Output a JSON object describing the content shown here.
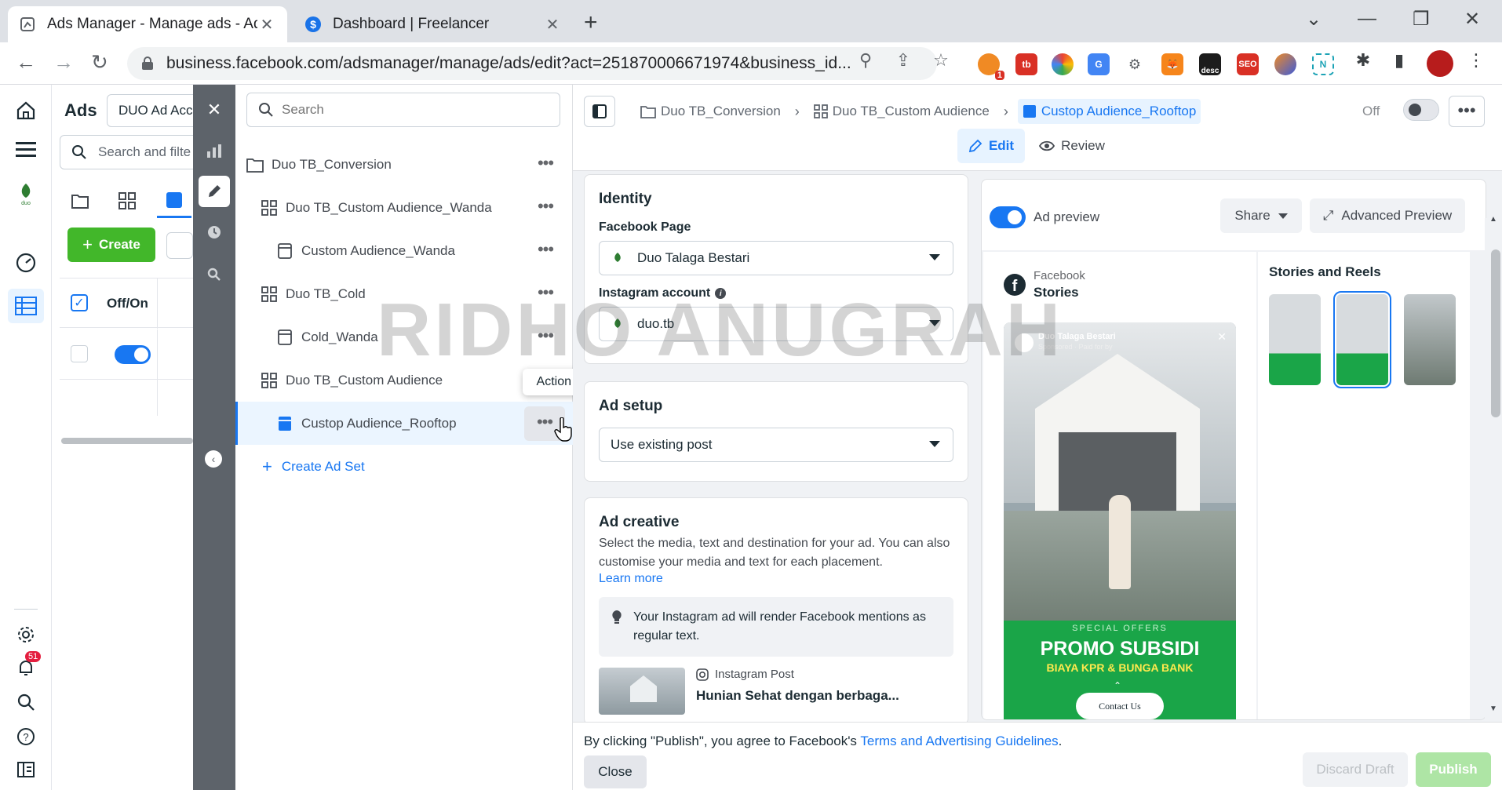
{
  "browser": {
    "tabs": [
      {
        "title": "Ads Manager - Manage ads - Ad",
        "active": true
      },
      {
        "title": "Dashboard | Freelancer",
        "active": false
      }
    ],
    "url": "business.facebook.com/adsmanager/manage/ads/edit?act=251870006671974&business_id...",
    "ext_badge": "1",
    "ext_desc": "desc",
    "ext_seo": "SEO"
  },
  "appnav": {
    "notif_count": "51"
  },
  "ads_panel": {
    "title": "Ads",
    "account": "DUO Ad Acco",
    "search_placeholder": "Search and filte",
    "create_label": "Create",
    "col_header": "Off/On"
  },
  "tree": {
    "search_placeholder": "Search",
    "items": [
      {
        "label": "Duo TB_Conversion",
        "type": "campaign"
      },
      {
        "label": "Duo TB_Custom Audience_Wanda",
        "type": "adset"
      },
      {
        "label": "Custom Audience_Wanda",
        "type": "ad"
      },
      {
        "label": "Duo TB_Cold",
        "type": "adset"
      },
      {
        "label": "Cold_Wanda",
        "type": "ad"
      },
      {
        "label": "Duo TB_Custom Audience",
        "type": "adset"
      },
      {
        "label": "Custop Audience_Rooftop",
        "type": "ad",
        "selected": true
      }
    ],
    "create_adset": "Create Ad Set",
    "tooltip": "Action menu"
  },
  "editor": {
    "breadcrumb": [
      "Duo TB_Conversion",
      "Duo TB_Custom Audience",
      "Custop Audience_Rooftop"
    ],
    "status": "Off",
    "edit_tab": "Edit",
    "review_tab": "Review",
    "identity": {
      "title": "Identity",
      "fb_label": "Facebook Page",
      "fb_value": "Duo Talaga Bestari",
      "ig_label": "Instagram account",
      "ig_value": "duo.tb"
    },
    "ad_setup": {
      "title": "Ad setup",
      "value": "Use existing post"
    },
    "creative": {
      "title": "Ad creative",
      "desc": "Select the media, text and destination for your ad. You can also customise your media and text for each placement.",
      "learn_more": "Learn more",
      "notice": "Your Instagram ad will render Facebook mentions as regular text.",
      "post_type": "Instagram Post",
      "post_title": "Hunian Sehat dengan berbaga..."
    },
    "preview": {
      "toggle_label": "Ad preview",
      "share": "Share",
      "advanced": "Advanced Preview",
      "platform": "Facebook",
      "placement": "Stories",
      "story_page": "Duo Talaga Bestari",
      "story_sub": "Sponsored · Paid for by",
      "promo_tag": "SPECIAL OFFERS",
      "promo_title": "PROMO SUBSIDI",
      "promo_sub": "BIAYA KPR & BUNGA BANK",
      "cta": "Contact Us",
      "reels_title": "Stories and Reels"
    },
    "footer": {
      "legal_prefix": "By clicking \"Publish\", you agree to Facebook's ",
      "legal_link": "Terms and Advertising Guidelines",
      "legal_suffix": ".",
      "close": "Close",
      "discard": "Discard Draft",
      "publish": "Publish"
    }
  },
  "watermark": "RIDHO ANUGRAH"
}
